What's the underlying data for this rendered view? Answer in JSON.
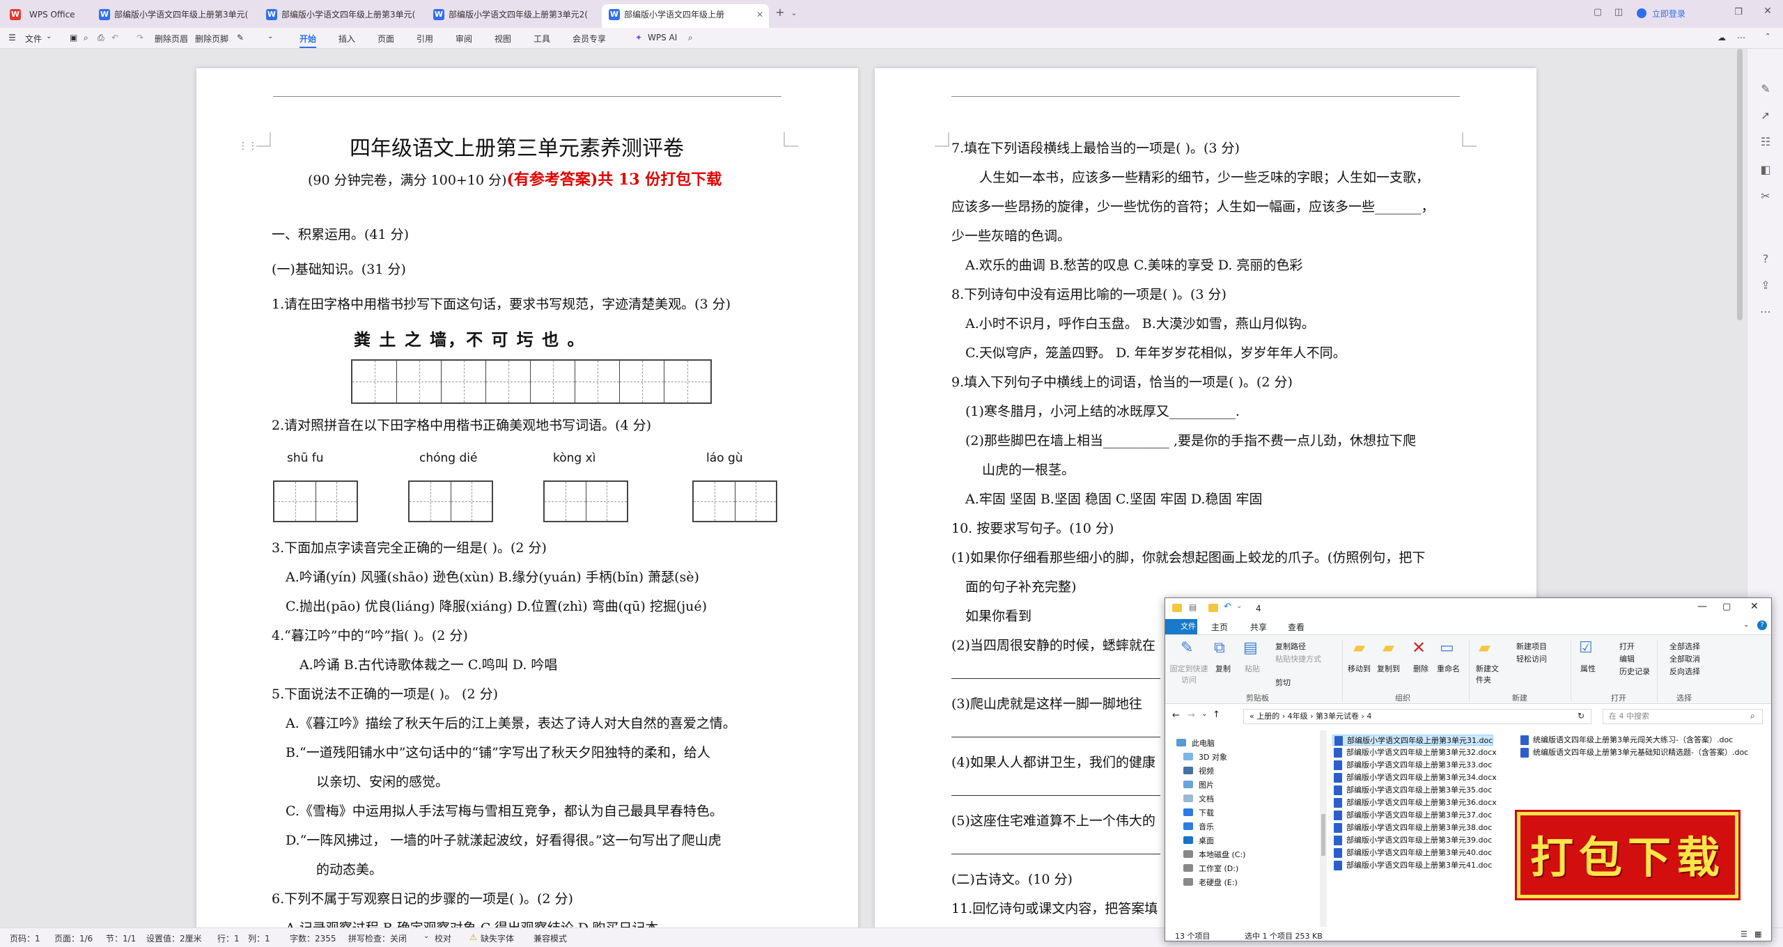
{
  "tabs": [
    {
      "label": "WPS Office"
    },
    {
      "label": "部编版小学语文四年级上册第3单元("
    },
    {
      "label": "部编版小学语文四年级上册第3单元("
    },
    {
      "label": "部编版小学语文四年级上册第3单元2("
    },
    {
      "label": "部编版小学语文四年级上册"
    }
  ],
  "header_right": {
    "login": "立即登录"
  },
  "toolbar": {
    "file": "文件",
    "delete_header": "删除页眉",
    "delete_footer": "删除页脚",
    "menus": [
      "开始",
      "插入",
      "页面",
      "引用",
      "审阅",
      "视图",
      "工具",
      "会员专享"
    ],
    "ai": "WPS AI"
  },
  "page1": {
    "title": "四年级语文上册第三单元素养测评卷",
    "subtitle": "(90 分钟完卷，满分 100+10 分)",
    "subtitle_red": "(有参考答案)共 13 份打包下载",
    "sec1": "一、积累运用。(41 分)",
    "sec1a": "(一)基础知识。(31 分)",
    "q1": "1.请在田字格中用楷书抄写下面这句话，要求书写规范，字迹清楚美观。(3 分)",
    "q1_sentence": "粪 土 之 墙，不 可  圬  也 。",
    "q2": "2.请对照拼音在以下田字格中用楷书正确美观地书写词语。(4 分)",
    "pinyin": [
      "shū     fu",
      "chóng   dié",
      "kòng   xì",
      "láo   gù"
    ],
    "q3": "3.下面加点字读音完全正确的一组是(        )。(2 分)",
    "q3_a": "A.吟诵(yín)   风骚(shāo)   逊色(xùn)         B.缘分(yuán)   手柄(bǐn)   萧瑟(sè)",
    "q3_c": "C.抛出(pāo)  优良(liáng)     降服(xiáng)       D.位置(zhì)   弯曲(qū)    挖掘(jué)",
    "q4": "4.“暮江吟”中的“吟”指(          )。(2 分)",
    "q4_opts": "A.吟诵          B.古代诗歌体裁之一              C.鸣叫              D.  吟唱",
    "q5": "5.下面说法不正确的一项是(          )。 (2 分)",
    "q5_a": "A.《暮江吟》描绘了秋天午后的江上美景，表达了诗人对大自然的喜爱之情。",
    "q5_b1": "B.“一道残阳铺水中”这句话中的“铺”字写出了秋天夕阳独特的柔和，给人",
    "q5_b2": "以亲切、安闲的感觉。",
    "q5_c": "C.《雪梅》中运用拟人手法写梅与雪相互竞争，都认为自己最具早春特色。",
    "q5_d1": "D.“一阵风拂过，  一墙的叶子就漾起波纹，好看得很。”这一句写出了爬山虎",
    "q5_d2": "的动态美。",
    "q6": "6.下列不属于写观察日记的步骤的一项是(          )。(2 分)",
    "q6_opts": "A.记录观察过程     B.确定观察对象      C.得出观察结论          D.购买日记本"
  },
  "page2": {
    "q7": "7.填在下列语段横线上最恰当的一项是(          )。(3 分)",
    "q7_p1": "人生如一本书，应该多一些精彩的细节，少一些乏味的字眼；人生如一支歌，",
    "q7_p2": "应该多一些昂扬的旋律，少一些忧伤的音符；人生如一幅画，应该多一些_______，",
    "q7_p3": "少一些灰暗的色调。",
    "q7_opts": "A.欢乐的曲调          B.愁苦的叹息           C.美味的享受              D.  亮丽的色彩",
    "q8": "8.下列诗句中没有运用比喻的一项是(          )。(3 分)",
    "q8_ab": "A.小时不识月，呼作白玉盘。              B.大漠沙如雪，燕山月似钩。",
    "q8_cd": "C.天似穹庐，笼盖四野。                  D.  年年岁岁花相似，岁岁年年人不同。",
    "q9": "9.填入下列句子中横线上的词语，恰当的一项是(          )。(2 分)",
    "q9_1": "(1)寒冬腊月，小河上结的冰既厚又__________.",
    "q9_2a": "(2)那些脚巴在墙上相当__________ ,要是你的手指不费一点儿劲，休想拉下爬",
    "q9_2b": "山虎的一根茎。",
    "q9_opts": "A.牢固  坚固              B.坚固  稳固              C.坚固  牢固                D.稳固  牢固",
    "q10": "10.  按要求写句子。(10 分)",
    "q10_1a": "(1)如果你仔细看那些细小的脚，你就会想起图画上蛟龙的爪子。(仿照例句，把下",
    "q10_1b": "面的句子补充完整)",
    "q10_1c": "如果你看到",
    "q10_2": "(2)当四周很安静的时候，蟋蟀就在",
    "q10_3": "(3)爬山虎就是这样一脚一脚地往",
    "q10_4": "(4)如果人人都讲卫生，我们的健康",
    "q10_5": "(5)这座住宅难道算不上一个伟大的",
    "sec2": "(二)古诗文。(10 分)",
    "q11": "11.回忆诗句或课文内容，把答案填"
  },
  "statusbar": {
    "page_no": "页码：1",
    "pages": "页面：1/6",
    "section": "节：1/1",
    "setting": "设置值：2厘米",
    "row": "行：1",
    "col": "列：1",
    "words": "字数：2355",
    "spell": "拼写检查：关闭",
    "proof": "校对",
    "missing_font": "缺失字体",
    "compat": "兼容模式"
  },
  "explorer": {
    "title": "4",
    "tabs": [
      "文件",
      "主页",
      "共享",
      "查看"
    ],
    "ribbon": {
      "pin": "固定到快速访问",
      "copy": "复制",
      "paste": "粘贴",
      "copy_path": "复制路径",
      "paste_shortcut": "粘贴快捷方式",
      "cut": "剪切",
      "clipboard": "剪贴板",
      "move_to": "移动到",
      "copy_to": "复制到",
      "delete": "删除",
      "rename": "重命名",
      "organize": "组织",
      "new_folder": "新建文件夹",
      "new_item": "新建项目",
      "easy_access": "轻松访问",
      "new": "新建",
      "properties": "属性",
      "open": "打开",
      "edit": "编辑",
      "history": "历史记录",
      "open_group": "打开",
      "select_all": "全部选择",
      "select_none": "全部取消",
      "invert": "反向选择",
      "select": "选择"
    },
    "address": "«   上册的    ›   4年级   ›   第3单元试卷   ›   4",
    "search_placeholder": "在 4 中搜索",
    "nav": [
      "此电脑",
      "3D 对象",
      "视频",
      "图片",
      "文档",
      "下载",
      "音乐",
      "桌面",
      "本地磁盘 (C:)",
      "工作室 (D:)",
      "老硬盘 (E:)"
    ],
    "files_col1": [
      "部编版小学语文四年级上册第3单元31.doc",
      "部编版小学语文四年级上册第3单元32.docx",
      "部编版小学语文四年级上册第3单元33.doc",
      "部编版小学语文四年级上册第3单元34.docx",
      "部编版小学语文四年级上册第3单元35.doc",
      "部编版小学语文四年级上册第3单元36.docx",
      "部编版小学语文四年级上册第3单元37.doc",
      "部编版小学语文四年级上册第3单元38.doc",
      "部编版小学语文四年级上册第3单元39.doc",
      "部编版小学语文四年级上册第3单元40.doc",
      "部编版小学语文四年级上册第3单元41.doc"
    ],
    "files_col2": [
      "统编版语文四年级上册第3单元闯关大练习-（含答案）.doc",
      "统编版语文四年级上册第3单元基础知识精选题-（含答案）.doc"
    ],
    "status_count": "13 个项目",
    "status_selected": "选中 1 个项目  253 KB"
  },
  "banner": {
    "text": "打包下载"
  }
}
